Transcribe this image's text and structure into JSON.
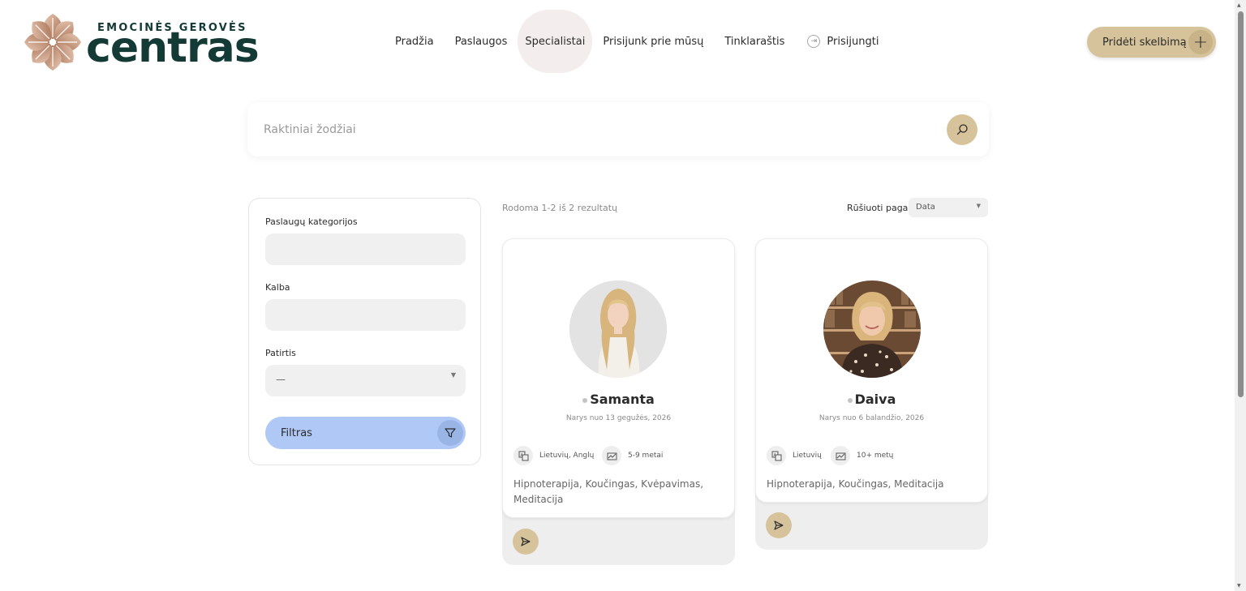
{
  "logo": {
    "subtitle": "EMOCINĖS GEROVĖS",
    "title": "centras",
    "colors": {
      "petal_light": "#e9c9b5",
      "petal_dark": "#a36c4e",
      "text": "#143a35"
    }
  },
  "nav": {
    "items": [
      {
        "label": "Pradžia"
      },
      {
        "label": "Paslaugos"
      },
      {
        "label": "Specialistai",
        "active": true
      },
      {
        "label": "Prisijunk prie mūsų"
      },
      {
        "label": "Tinklaraštis"
      }
    ],
    "login_label": "Prisijungti",
    "login_icon": "login-arrow-icon"
  },
  "add_listing": {
    "label": "Pridėti skelbimą",
    "icon": "plus-icon"
  },
  "search": {
    "placeholder": "Raktiniai žodžiai",
    "value": "",
    "icon": "search-icon"
  },
  "filters": {
    "category_label": "Paslaugų kategorijos",
    "category_value": "",
    "language_label": "Kalba",
    "language_value": "",
    "experience_label": "Patirtis",
    "experience_value": "—",
    "button_label": "Filtras",
    "button_icon": "funnel-icon"
  },
  "results": {
    "count_text": "Rodoma 1-2 iš 2 rezultatų",
    "sort_label": "Rūšiuoti pagal",
    "sort_value": "Data"
  },
  "specialists": [
    {
      "name": "Samanta",
      "member_since": "Narys nuo 13 gegužės, 2026",
      "languages": "Lietuvių, Anglų",
      "experience": "5-9 metai",
      "services": "Hipnoterapija, Koučingas, Kvėpavimas, Meditacija",
      "status": "offline"
    },
    {
      "name": "Daiva",
      "member_since": "Narys nuo 6 balandžio, 2026",
      "languages": "Lietuvių",
      "experience": "10+ metų",
      "services": "Hipnoterapija, Koučingas, Meditacija",
      "status": "offline"
    }
  ],
  "colors": {
    "accent_gold": "#d6c39b",
    "filter_blue": "#b0c8f5",
    "nav_active_bg": "#f3eeed",
    "field_bg": "#f0f0f0"
  }
}
